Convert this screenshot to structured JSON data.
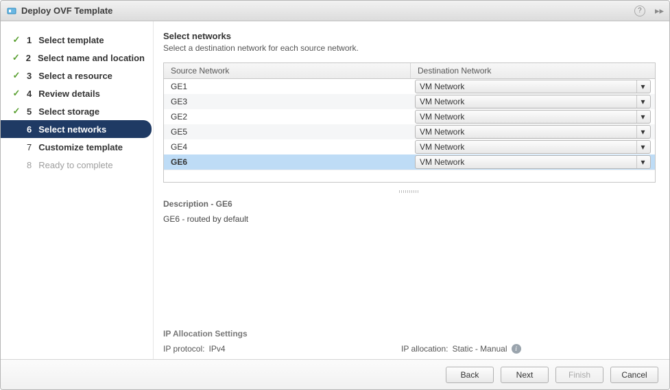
{
  "window": {
    "title": "Deploy OVF Template"
  },
  "wizard": {
    "steps": [
      {
        "num": "1",
        "label": "Select template",
        "state": "done"
      },
      {
        "num": "2",
        "label": "Select name and location",
        "state": "done"
      },
      {
        "num": "3",
        "label": "Select a resource",
        "state": "done"
      },
      {
        "num": "4",
        "label": "Review details",
        "state": "done"
      },
      {
        "num": "5",
        "label": "Select storage",
        "state": "done"
      },
      {
        "num": "6",
        "label": "Select networks",
        "state": "current"
      },
      {
        "num": "7",
        "label": "Customize template",
        "state": "future"
      },
      {
        "num": "8",
        "label": "Ready to complete",
        "state": "disabled"
      }
    ]
  },
  "page": {
    "title": "Select networks",
    "subtitle": "Select a destination network for each source network."
  },
  "table": {
    "columns": {
      "source": "Source Network",
      "destination": "Destination Network"
    },
    "rows": [
      {
        "source": "GE1",
        "destination": "VM Network",
        "selected": false
      },
      {
        "source": "GE3",
        "destination": "VM Network",
        "selected": false
      },
      {
        "source": "GE2",
        "destination": "VM Network",
        "selected": false
      },
      {
        "source": "GE5",
        "destination": "VM Network",
        "selected": false
      },
      {
        "source": "GE4",
        "destination": "VM Network",
        "selected": false
      },
      {
        "source": "GE6",
        "destination": "VM Network",
        "selected": true
      }
    ]
  },
  "description": {
    "title": "Description - GE6",
    "text": "GE6 - routed by default"
  },
  "ip_settings": {
    "title": "IP Allocation Settings",
    "protocol_label": "IP protocol:",
    "protocol_value": "IPv4",
    "allocation_label": "IP allocation:",
    "allocation_value": "Static - Manual"
  },
  "footer": {
    "back": "Back",
    "next": "Next",
    "finish": "Finish",
    "cancel": "Cancel"
  }
}
